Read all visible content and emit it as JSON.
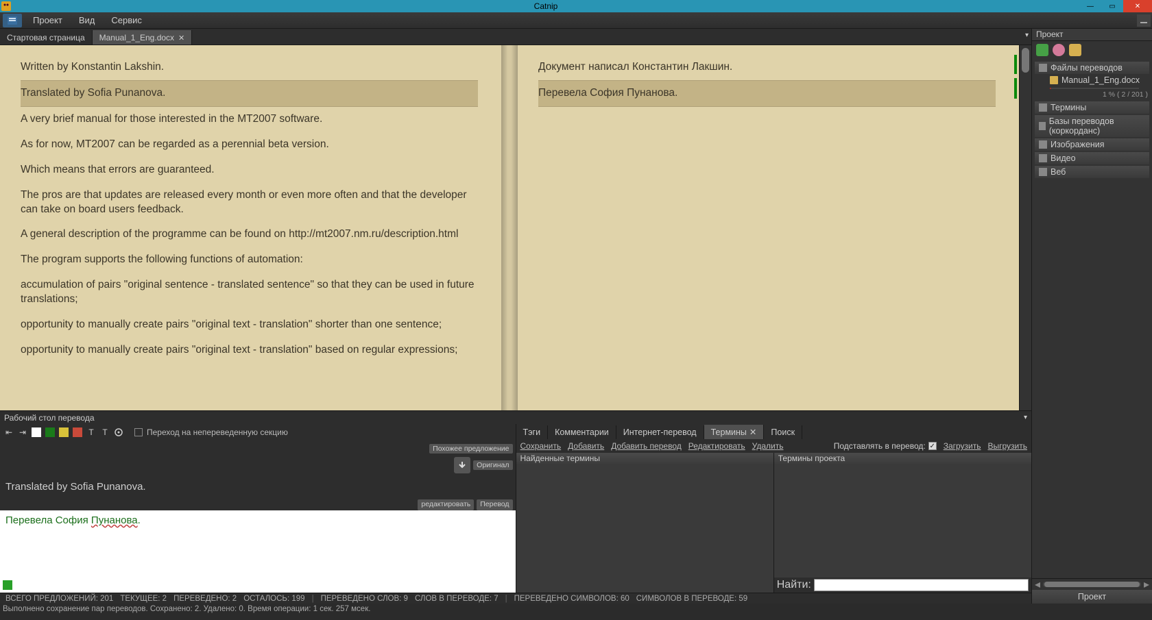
{
  "app": {
    "title": "Catnip"
  },
  "menu": {
    "items": [
      "Проект",
      "Вид",
      "Сервис"
    ]
  },
  "tabs": {
    "start": "Стартовая страница",
    "doc": "Manual_1_Eng.docx"
  },
  "segments": {
    "source": [
      "Written by Konstantin Lakshin.",
      "Translated by Sofia Punanova.",
      "A very brief manual for those interested in the MT2007 software.",
      "As for now, MT2007 can be regarded as a perennial beta version.",
      "Which means that errors are guaranteed.",
      "The pros are that updates are released every month or even more often and that the developer can take on board users feedback.",
      "A general description of the programme can be found on http://mt2007.nm.ru/description.html",
      "The program supports the following functions of automation:",
      "accumulation of pairs \"original sentence - translated sentence\" so that they can be used in future translations;",
      "opportunity to manually create pairs \"original text - translation\" shorter than one sentence;",
      "opportunity to manually create pairs \"original text - translation\" based on regular expressions;"
    ],
    "target": [
      "Документ написал Константин Лакшин.",
      "Перевела София Пунанова."
    ],
    "selectedIndex": 1
  },
  "workspace": {
    "title": "Рабочий стол перевода",
    "gotoUntranslated": "Переход на непереведенную секцию",
    "badges": {
      "similar": "Похожее предложение",
      "original": "Оригинал",
      "edit": "редактировать",
      "translation": "Перевод"
    },
    "original": "Translated by Sofia Punanova.",
    "edit_prefix": "Перевела София ",
    "edit_underlined": "Пунанова",
    "edit_suffix": "."
  },
  "rightTabs": {
    "tags": "Тэги",
    "comments": "Комментарии",
    "internet": "Интернет-перевод",
    "terms": "Термины",
    "search": "Поиск"
  },
  "termToolbar": {
    "save": "Сохранить",
    "add": "Добавить",
    "addTrans": "Добавить перевод",
    "edit": "Редактировать",
    "delete": "Удалить",
    "substitute": "Подставлять в перевод:",
    "load": "Загрузить",
    "export": "Выгрузить"
  },
  "termCols": {
    "found": "Найденные термины",
    "project": "Термины проекта",
    "find": "Найти:"
  },
  "project": {
    "title": "Проект",
    "button": "Проект",
    "groups": {
      "files": "Файлы переводов",
      "terms": "Термины",
      "tm": "Базы переводов (коркорданс)",
      "images": "Изображения",
      "video": "Видео",
      "web": "Веб"
    },
    "file": {
      "name": "Manual_1_Eng.docx",
      "progress": "1 %   ( 2 / 201 )"
    }
  },
  "stats": {
    "total": "ВСЕГО ПРЕДЛОЖЕНИЙ: 201",
    "current": "ТЕКУЩЕЕ: 2",
    "translated": "ПЕРЕВЕДЕНО: 2",
    "remaining": "ОСТАЛОСЬ: 199",
    "wordsDone": "ПЕРЕВЕДЕНО СЛОВ: 9",
    "wordsIn": "СЛОВ В ПЕРЕВОДЕ: 7",
    "charsDone": "ПЕРЕВЕДЕНО СИМВОЛОВ: 60",
    "charsIn": "СИМВОЛОВ В ПЕРЕВОДЕ: 59"
  },
  "status": "Выполнено сохранение пар переводов. Сохранено: 2. Удалено: 0. Время операции: 1 сек. 257 мсек."
}
